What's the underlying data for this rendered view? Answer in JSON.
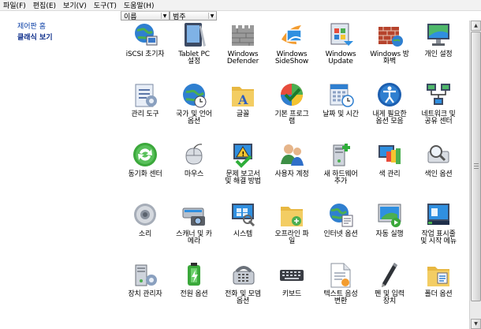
{
  "menu": [
    "파일(F)",
    "편집(E)",
    "보기(V)",
    "도구(T)",
    "도움말(H)"
  ],
  "nav": {
    "home": "제어판 홈",
    "classic": "클래식 보기"
  },
  "columns": [
    "이름",
    "범주"
  ],
  "items": [
    {
      "label": "iSCSI 초기자",
      "icon": "globe-network-icon"
    },
    {
      "label": "Tablet PC\n설정",
      "icon": "tablet-pc-icon"
    },
    {
      "label": "Windows\nDefender",
      "icon": "castle-wall-icon"
    },
    {
      "label": "Windows\nSideShow",
      "icon": "sideshow-icon"
    },
    {
      "label": "Windows\nUpdate",
      "icon": "windows-update-icon"
    },
    {
      "label": "Windows 방\n화벽",
      "icon": "firewall-icon"
    },
    {
      "label": "개인 설정",
      "icon": "monitor-personalize-icon"
    },
    {
      "label": "관리 도구",
      "icon": "admin-tools-icon"
    },
    {
      "label": "국가 및 언어\n옵션",
      "icon": "globe-clock-icon"
    },
    {
      "label": "글꼴",
      "icon": "fonts-folder-icon"
    },
    {
      "label": "기본 프로그\n램",
      "icon": "default-programs-icon"
    },
    {
      "label": "날짜 및 시간",
      "icon": "date-time-icon"
    },
    {
      "label": "내게 필요한\n옵션 모음",
      "icon": "ease-of-access-icon"
    },
    {
      "label": "네트워크 및\n공유 센터",
      "icon": "network-center-icon"
    },
    {
      "label": "동기화 센터",
      "icon": "sync-icon"
    },
    {
      "label": "마우스",
      "icon": "mouse-icon"
    },
    {
      "label": "문제 보고서\n및 해결 방법",
      "icon": "problem-reports-icon"
    },
    {
      "label": "사용자 계정",
      "icon": "user-accounts-icon"
    },
    {
      "label": "새 하드웨어\n추가",
      "icon": "add-hardware-icon"
    },
    {
      "label": "색 관리",
      "icon": "color-management-icon"
    },
    {
      "label": "색인 옵션",
      "icon": "indexing-icon"
    },
    {
      "label": "소리",
      "icon": "speaker-icon"
    },
    {
      "label": "스캐너 및 카\n메라",
      "icon": "scanner-camera-icon"
    },
    {
      "label": "시스템",
      "icon": "system-icon"
    },
    {
      "label": "오프라인 파\n일",
      "icon": "offline-files-icon"
    },
    {
      "label": "인터넷 옵션",
      "icon": "internet-options-icon"
    },
    {
      "label": "자동 실행",
      "icon": "autoplay-icon"
    },
    {
      "label": "작업 표시줄\n및 시작 메뉴",
      "icon": "taskbar-icon"
    },
    {
      "label": "장치 관리자",
      "icon": "device-manager-icon"
    },
    {
      "label": "전원 옵션",
      "icon": "power-options-icon"
    },
    {
      "label": "전화 및 모뎀\n옵션",
      "icon": "phone-modem-icon"
    },
    {
      "label": "키보드",
      "icon": "keyboard-icon"
    },
    {
      "label": "텍스트 음성\n변환",
      "icon": "text-to-speech-icon"
    },
    {
      "label": "펜 및 입력\n장치",
      "icon": "pen-input-icon"
    },
    {
      "label": "폴더 옵션",
      "icon": "folder-options-icon"
    }
  ]
}
